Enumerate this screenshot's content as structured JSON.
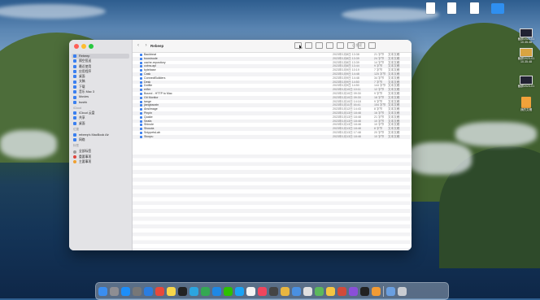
{
  "finder": {
    "title": "Rebeep",
    "search_placeholder": "Q 搜索",
    "sidebar": {
      "sections": [
        {
          "header": "",
          "items": [
            {
              "label": "Rebeep",
              "selected": true
            },
            {
              "label": "隔空投送"
            },
            {
              "label": "最近使用"
            },
            {
              "label": "应用程序"
            },
            {
              "label": "桌面"
            },
            {
              "label": "文稿"
            },
            {
              "label": "下载"
            },
            {
              "label": "音乐 Mac 3"
            },
            {
              "label": "Movies"
            },
            {
              "label": "bushk"
            }
          ]
        },
        {
          "header": "iCloud",
          "items": [
            {
              "label": "iCloud 云盘"
            },
            {
              "label": "共享"
            },
            {
              "label": "桌面"
            }
          ]
        },
        {
          "header": "位置",
          "items": [
            {
              "label": "rebeep's MacBook Air"
            },
            {
              "label": "网络"
            }
          ]
        },
        {
          "header": "标签",
          "items": [
            {
              "label": "全部标签",
              "color": "#9b9b9b"
            },
            {
              "label": "重要事项",
              "color": "#e0443c"
            },
            {
              "label": "主要事项",
              "color": "#f0a030"
            }
          ]
        }
      ]
    },
    "files": [
      {
        "name": "Backbeat",
        "date": "2023年1月8日 13:38",
        "size": "21 字节",
        "kind": "文本文稿"
      },
      {
        "name": "boostnode",
        "date": "2023年1月8日 13:39",
        "size": "24 字节",
        "kind": "文本文稿"
      },
      {
        "name": "cache-repository",
        "date": "2023年1月8日 13:39",
        "size": "14 字节",
        "kind": "文本文稿"
      },
      {
        "name": "cobra-api",
        "date": "2023年1月8日 13:44",
        "size": "9 字节",
        "kind": "文本文稿"
      },
      {
        "name": "bytebase",
        "date": "2023年1月9日 10:19",
        "size": "7 字节",
        "kind": "文本文稿"
      },
      {
        "name": "Cask",
        "date": "2023年1月9日 14:48",
        "size": "125 字节",
        "kind": "文本文稿"
      },
      {
        "name": "ConnectBuilders",
        "date": "2023年1月9日 14:48",
        "size": "34 字节",
        "kind": "文本文稿"
      },
      {
        "name": "Desk",
        "date": "2023年1月9日 14:50",
        "size": "7 字节",
        "kind": "文本文稿"
      },
      {
        "name": "Dotfile",
        "date": "2023年1月9日 14:50",
        "size": "144 字节",
        "kind": "文本文稿"
      },
      {
        "name": "erifer",
        "date": "2023年1月10日 10:11",
        "size": "12 字节",
        "kind": "文本文稿"
      },
      {
        "name": "Bound - HTTP to Mac",
        "date": "2023年1月10日 09:30",
        "size": "9 字节",
        "kind": "文本文稿"
      },
      {
        "name": "Git Monitor",
        "date": "2023年1月10日 09:30",
        "size": "18 字节",
        "kind": "文本文稿"
      },
      {
        "name": "tange",
        "date": "2023年1月10日 14:18",
        "size": "9 字节",
        "kind": "文本文稿"
      },
      {
        "name": "jiangbaoxin",
        "date": "2023年1月11日 16:41",
        "size": "154 字节",
        "kind": "文本文稿"
      },
      {
        "name": "Ansiimage",
        "date": "2023年1月12日 14:43",
        "size": "8 字节",
        "kind": "文本文稿"
      },
      {
        "name": "Pinpin",
        "date": "2023年1月13日 18:48",
        "size": "16 字节",
        "kind": "文本文稿"
      },
      {
        "name": "Quake",
        "date": "2023年1月13日 18:48",
        "size": "21 字节",
        "kind": "文本文稿"
      },
      {
        "name": "Seafa",
        "date": "2023年1月13日 18:48",
        "size": "10 字节",
        "kind": "文本文稿"
      },
      {
        "name": "Shinole",
        "date": "2023年1月13日 18:48",
        "size": "10 字节",
        "kind": "文本文稿"
      },
      {
        "name": "Shouda",
        "date": "2023年1月13日 18:48",
        "size": "8 字节",
        "kind": "文本文稿"
      },
      {
        "name": "SnippetsLab",
        "date": "2023年1月13日 17:48",
        "size": "20 字节",
        "kind": "文本文稿"
      },
      {
        "name": "Stoopu",
        "date": "2023年1月13日 18:48",
        "size": "10 字节",
        "kind": "文本文稿"
      }
    ]
  },
  "desktop": {
    "icons": [
      {
        "label": "",
        "type": "doc"
      },
      {
        "label": "",
        "type": "doc"
      },
      {
        "label": "",
        "type": "doc"
      },
      {
        "label": "",
        "type": "folder"
      },
      {
        "label": "截屏2023-01 10.35.48",
        "type": "shot"
      },
      {
        "label": "截屏2023-01 10.35.48",
        "type": "shot"
      },
      {
        "label": "截屏2023-01",
        "type": "shot"
      },
      {
        "label": "我的文稿",
        "type": "orange"
      }
    ]
  },
  "dock": {
    "apps": [
      {
        "name": "Finder",
        "color": "#3b8ef0"
      },
      {
        "name": "Launchpad",
        "color": "#8e8e93"
      },
      {
        "name": "App Store",
        "color": "#1c8ef9"
      },
      {
        "name": "Settings",
        "color": "#777777"
      },
      {
        "name": "Safari",
        "color": "#2b7de0"
      },
      {
        "name": "Chrome",
        "color": "#e7493b"
      },
      {
        "name": "Notes",
        "color": "#f7d64a"
      },
      {
        "name": "Terminal",
        "color": "#222222"
      },
      {
        "name": "Telegram",
        "color": "#2ca5e0"
      },
      {
        "name": "Chrome 2",
        "color": "#34a853"
      },
      {
        "name": "VS Code",
        "color": "#1e88e5"
      },
      {
        "name": "WeChat",
        "color": "#2dc100"
      },
      {
        "name": "QQ",
        "color": "#1aa3f4"
      },
      {
        "name": "Calendar",
        "color": "#f4f4f4"
      },
      {
        "name": "Music",
        "color": "#f0455d"
      },
      {
        "name": "Calculator",
        "color": "#444444"
      },
      {
        "name": "Photos",
        "color": "#e8b640"
      },
      {
        "name": "Mail",
        "color": "#4a90e2"
      },
      {
        "name": "Files",
        "color": "#e0e0e0"
      },
      {
        "name": "Maps",
        "color": "#5cb85c"
      },
      {
        "name": "Butterfly",
        "color": "#f5c542"
      },
      {
        "name": "Editor",
        "color": "#d14a3a"
      },
      {
        "name": "Screen",
        "color": "#8a4fd8"
      },
      {
        "name": "Video",
        "color": "#222222"
      },
      {
        "name": "Preview",
        "color": "#f29b34"
      },
      {
        "name": "Downloads",
        "color": "#6a9fe0"
      },
      {
        "name": "Trash",
        "color": "#c9ccd2"
      }
    ]
  }
}
